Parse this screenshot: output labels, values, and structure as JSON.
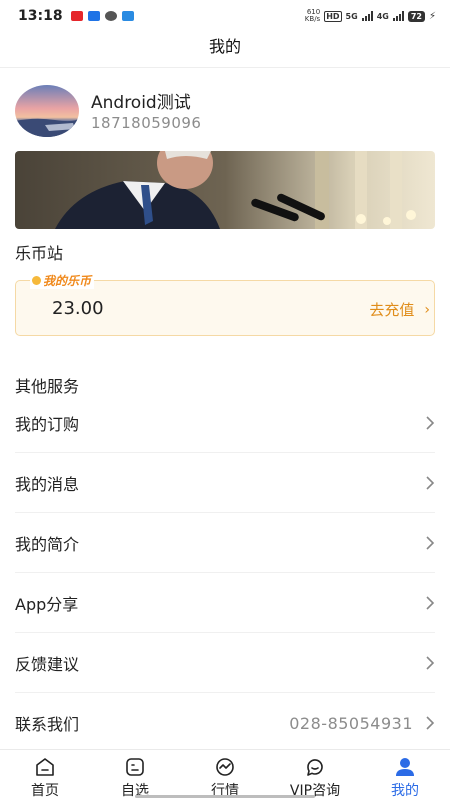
{
  "status_bar": {
    "time": "13:18",
    "net_speed_value": "610",
    "net_speed_unit": "KB/s",
    "hd_label": "HD",
    "network_5g": "5G",
    "network_4g": "4G",
    "battery": "72",
    "notification_colors": [
      "#e5262b",
      "#1f73e6",
      "#555555",
      "#2a8be2"
    ]
  },
  "header": {
    "title": "我的"
  },
  "profile": {
    "name": "Android测试",
    "phone": "18718059096"
  },
  "coin": {
    "section_title": "乐币站",
    "tag": "我的乐币",
    "balance": "23.00",
    "recharge_label": "去充值"
  },
  "services": {
    "section_title": "其他服务",
    "items": [
      {
        "label": "我的订购",
        "value": ""
      },
      {
        "label": "我的消息",
        "value": ""
      },
      {
        "label": "我的简介",
        "value": ""
      },
      {
        "label": "App分享",
        "value": ""
      },
      {
        "label": "反馈建议",
        "value": ""
      },
      {
        "label": "联系我们",
        "value": "028-85054931"
      }
    ]
  },
  "nav": {
    "items": [
      {
        "label": "首页",
        "icon": "home-icon"
      },
      {
        "label": "自选",
        "icon": "watchlist-icon"
      },
      {
        "label": "行情",
        "icon": "market-icon"
      },
      {
        "label": "VIP咨询",
        "icon": "chat-icon"
      },
      {
        "label": "我的",
        "icon": "profile-icon"
      }
    ],
    "active_index": 4,
    "active_color": "#2b6be6"
  }
}
